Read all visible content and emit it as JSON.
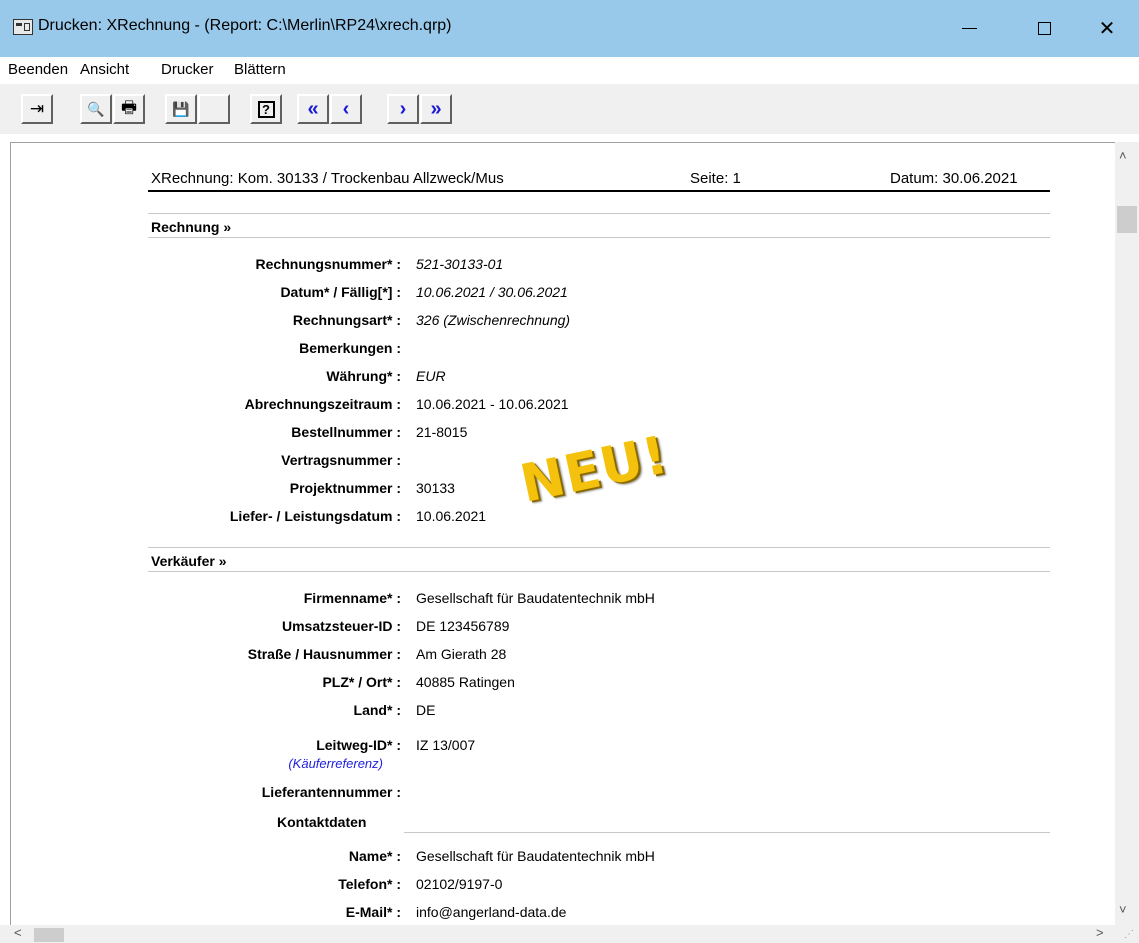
{
  "window": {
    "title": "Drucken: XRechnung  -  (Report: C:\\Merlin\\RP24\\xrech.qrp)",
    "close_glyph": "✕"
  },
  "menu": [
    "Beenden",
    "Ansicht",
    "Drucker",
    "Blättern"
  ],
  "toolbar": {
    "buttons": [
      {
        "name": "exit-icon",
        "glyph": "⇥"
      },
      {
        "name": "zoom-icon",
        "glyph": "🔍"
      },
      {
        "name": "print-icon",
        "glyph": "🖶"
      },
      {
        "name": "save-icon",
        "glyph": "💾"
      },
      {
        "name": "blank-icon",
        "glyph": ""
      },
      {
        "name": "help-icon",
        "glyph": "?"
      },
      {
        "name": "first-page-icon",
        "glyph": "«"
      },
      {
        "name": "prev-page-icon",
        "glyph": "‹"
      },
      {
        "name": "next-page-icon",
        "glyph": "›"
      },
      {
        "name": "last-page-icon",
        "glyph": "»"
      }
    ]
  },
  "report": {
    "header_title": "XRechnung: Kom. 30133 / Trockenbau Allzweck/Mus",
    "header_page": "Seite:  1",
    "header_date": "Datum: 30.06.2021",
    "stamp": "NEU!",
    "rechnung": {
      "heading": "Rechnung »",
      "rows": [
        {
          "label": "Rechnungsnummer* :",
          "value": "521-30133-01"
        },
        {
          "label": "Datum* / Fällig[*] :",
          "value": "10.06.2021  /  30.06.2021"
        },
        {
          "label": "Rechnungsart* :",
          "value": "326   (Zwischenrechnung)"
        },
        {
          "label": "Bemerkungen :",
          "value": ""
        },
        {
          "label": "Währung* :",
          "value": "EUR"
        },
        {
          "label": "Abrechnungszeitraum :",
          "value": "10.06.2021  - 10.06.2021"
        },
        {
          "label": "Bestellnummer :",
          "value": "21-8015"
        },
        {
          "label": "Vertragsnummer :",
          "value": ""
        },
        {
          "label": "Projektnummer :",
          "value": "30133"
        },
        {
          "label": "Liefer- / Leistungsdatum :",
          "value": "10.06.2021"
        }
      ]
    },
    "verkaeufer": {
      "heading": "Verkäufer »",
      "rows": [
        {
          "label": "Firmenname* :",
          "value": "Gesellschaft für Baudatentechnik mbH"
        },
        {
          "label": "Umsatzsteuer-ID :",
          "value": "DE 123456789"
        },
        {
          "label": "Straße / Hausnummer :",
          "value": "Am Gierath 28"
        },
        {
          "label": "PLZ* / Ort* :",
          "value": "40885     Ratingen"
        },
        {
          "label": "Land* :",
          "value": "DE"
        },
        {
          "label": "Leitweg-ID* :",
          "value": "IZ 13/007"
        },
        {
          "label": "Lieferantennummer :",
          "value": ""
        }
      ],
      "leitweg_note": "(Käuferreferenz)",
      "kontakt_heading": "Kontaktdaten",
      "kontakt_rows": [
        {
          "label": "Name* :",
          "value": "Gesellschaft für Baudatentechnik mbH"
        },
        {
          "label": "Telefon* :",
          "value": "02102/9197-0"
        },
        {
          "label": "E-Mail* :",
          "value": "info@angerland-data.de"
        }
      ]
    }
  }
}
